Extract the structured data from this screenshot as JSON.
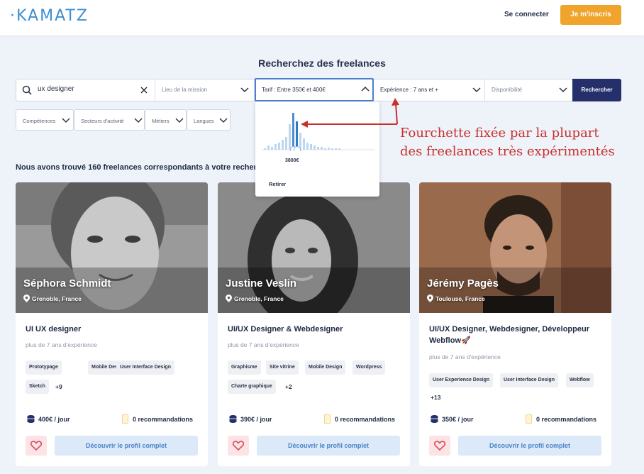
{
  "header": {
    "logo": "KAMATZ",
    "login_label": "Se connecter",
    "signup_label": "Je m'inscris"
  },
  "search": {
    "title": "Recherchez des freelances",
    "keyword_value": "ux designer",
    "location_placeholder": "Lieu de la mission",
    "tarif_label": "Tarif : Entre 350€ et 400€",
    "experience_label": "Expérience : 7 ans et +",
    "availability_placeholder": "Disponibilité",
    "search_button": "Rechercher"
  },
  "filters": [
    "Compétences",
    "Secteurs d'activité",
    "Métiers",
    "Langues"
  ],
  "tarif_dropdown": {
    "selected_value": "3800€",
    "remove_label": "Retirer"
  },
  "annotation": {
    "line1": "Fourchette fixée par la plupart",
    "line2": "des freelances très expérimentés"
  },
  "results": {
    "count_text": "Nous avons trouvé 160 freelances correspondants à votre recherche"
  },
  "cards": [
    {
      "name": "Séphora Schmidt",
      "location": "Grenoble, France",
      "job": "UI UX designer",
      "experience": "plus de 7 ans d'expérience",
      "tags": [
        "Prototypage",
        "Mobile Design",
        "User Interface Design",
        "Sketch"
      ],
      "more_tags": "+9",
      "price": "400€ / jour",
      "recommendations": "0 recommandations",
      "discover_label": "Découvrir le profil complet"
    },
    {
      "name": "Justine Veslin",
      "location": "Grenoble, France",
      "job": "UI/UX Designer & Webdesigner",
      "experience": "plus de 7 ans d'expérience",
      "tags": [
        "Graphisme",
        "Site vitrine",
        "Mobile Design",
        "Wordpress",
        "Charte graphique"
      ],
      "more_tags": "+2",
      "price": "390€ / jour",
      "recommendations": "0 recommandations",
      "discover_label": "Découvrir le profil complet"
    },
    {
      "name": "Jérémy Pagès",
      "location": "Toulouse, France",
      "job": "UI/UX Designer, Webdesigner, Développeur Webflow🚀",
      "experience": "plus de 7 ans d'expérience",
      "tags": [
        "User Experience Design",
        "User Interface Design",
        "Webflow"
      ],
      "more_tags": "+13",
      "price": "350€ / jour",
      "recommendations": "0 recommandations",
      "discover_label": "Découvrir le profil complet"
    }
  ],
  "colors": {
    "brand_blue": "#3f8fd1",
    "cta_orange": "#f0a42b",
    "search_navy": "#25306a",
    "annotation_red": "#c9302c",
    "discover_bg": "#dbe9f8"
  },
  "icons": [
    "search-icon",
    "clear-icon",
    "chevron-down-icon",
    "chevron-up-icon",
    "map-pin-icon",
    "coins-icon",
    "badge-icon",
    "heart-icon",
    "arrow-annotation-icon"
  ]
}
